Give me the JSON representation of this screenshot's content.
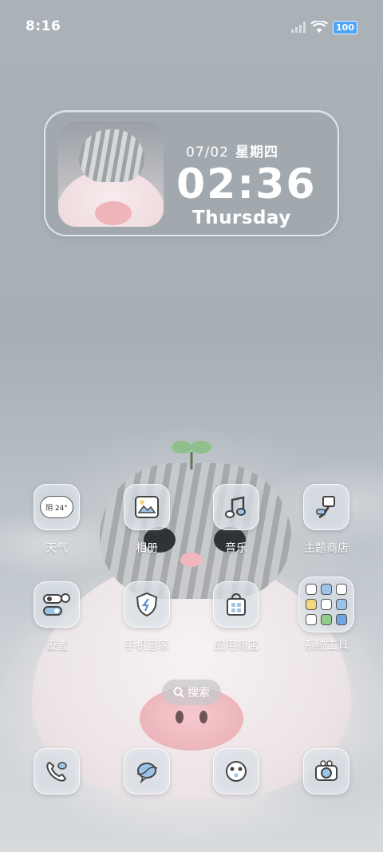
{
  "status_bar": {
    "time": "8:16",
    "battery": "100",
    "icons": [
      "cellular-signal-icon",
      "wifi-icon",
      "battery-icon"
    ]
  },
  "widget": {
    "date": "07/02",
    "weekday": "星期四",
    "time": "02:36",
    "day": "Thursday"
  },
  "weather_icon_text": "阴 24°",
  "apps": [
    {
      "label": "天气",
      "icon": "weather-icon"
    },
    {
      "label": "相册",
      "icon": "gallery-icon"
    },
    {
      "label": "音乐",
      "icon": "music-icon"
    },
    {
      "label": "主题商店",
      "icon": "theme-brush-icon"
    },
    {
      "label": "设置",
      "icon": "settings-toggle-icon"
    },
    {
      "label": "手机管家",
      "icon": "security-shield-icon"
    },
    {
      "label": "应用商店",
      "icon": "shopping-bag-icon"
    },
    {
      "label": "系统工具",
      "icon": "folder-icon"
    }
  ],
  "search": {
    "label": "搜索",
    "icon": "search-icon"
  },
  "dock": [
    {
      "icon": "phone-icon"
    },
    {
      "icon": "messages-icon"
    },
    {
      "icon": "browser-icon"
    },
    {
      "icon": "camera-icon"
    }
  ],
  "colors": {
    "battery": "#4da5f5",
    "wallpaper": "#a9b1b7"
  }
}
